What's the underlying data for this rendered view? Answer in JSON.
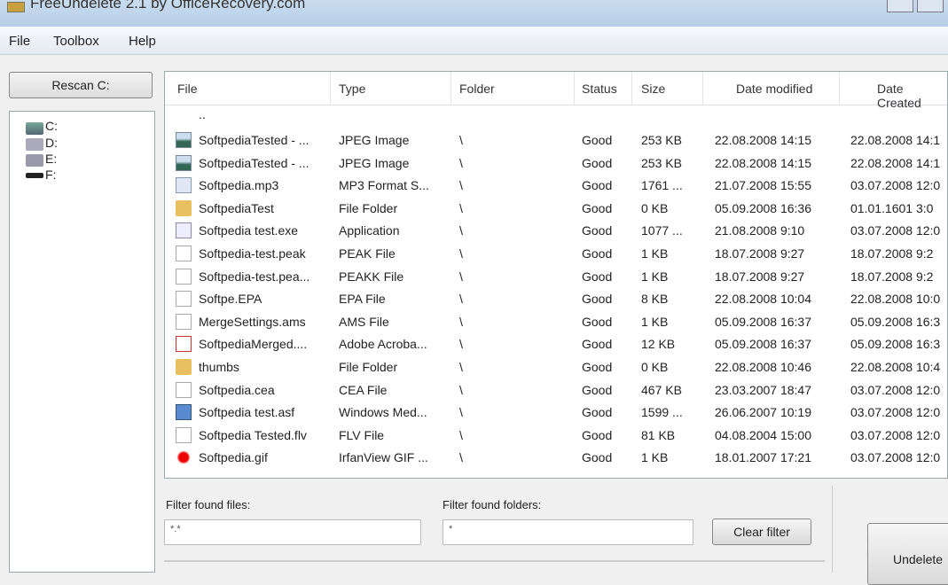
{
  "window": {
    "title": "FreeUndelete 2.1 by OfficeRecovery.com"
  },
  "menu": [
    "File",
    "Toolbox",
    "Help"
  ],
  "rescan_label": "Rescan C:",
  "drives": [
    "C:",
    "D:",
    "E:",
    "F:"
  ],
  "columns": [
    "File",
    "Type",
    "Folder",
    "Status",
    "Size",
    "Date modified",
    "Date Created"
  ],
  "parent_row": "..",
  "rows": [
    {
      "icon": "image-icon",
      "file": "SoftpediaTested - ...",
      "type": "JPEG Image",
      "folder": "\\",
      "status": "Good",
      "size": "253 KB",
      "modified": "22.08.2008 14:15",
      "created": "22.08.2008 14:1"
    },
    {
      "icon": "image-icon",
      "file": "SoftpediaTested - ...",
      "type": "JPEG Image",
      "folder": "\\",
      "status": "Good",
      "size": "253 KB",
      "modified": "22.08.2008 14:15",
      "created": "22.08.2008 14:1"
    },
    {
      "icon": "audio-icon",
      "file": "Softpedia.mp3",
      "type": "MP3 Format S...",
      "folder": "\\",
      "status": "Good",
      "size": "1761 ...",
      "modified": "21.07.2008 15:55",
      "created": "03.07.2008 12:0"
    },
    {
      "icon": "folder-icon",
      "file": "SoftpediaTest",
      "type": "File Folder",
      "folder": "\\",
      "status": "Good",
      "size": "0 KB",
      "modified": "05.09.2008 16:36",
      "created": "01.01.1601 3:0"
    },
    {
      "icon": "exe-icon",
      "file": "Softpedia test.exe",
      "type": "Application",
      "folder": "\\",
      "status": "Good",
      "size": "1077 ...",
      "modified": "21.08.2008 9:10",
      "created": "03.07.2008 12:0"
    },
    {
      "icon": "file-icon",
      "file": "Softpedia-test.peak",
      "type": "PEAK File",
      "folder": "\\",
      "status": "Good",
      "size": "1 KB",
      "modified": "18.07.2008 9:27",
      "created": "18.07.2008 9:2"
    },
    {
      "icon": "file-icon",
      "file": "Softpedia-test.pea...",
      "type": "PEAKK File",
      "folder": "\\",
      "status": "Good",
      "size": "1 KB",
      "modified": "18.07.2008 9:27",
      "created": "18.07.2008 9:2"
    },
    {
      "icon": "file-icon",
      "file": "Softpe.EPA",
      "type": "EPA File",
      "folder": "\\",
      "status": "Good",
      "size": "8 KB",
      "modified": "22.08.2008 10:04",
      "created": "22.08.2008 10:0"
    },
    {
      "icon": "file-icon",
      "file": "MergeSettings.ams",
      "type": "AMS File",
      "folder": "\\",
      "status": "Good",
      "size": "1 KB",
      "modified": "05.09.2008 16:37",
      "created": "05.09.2008 16:3"
    },
    {
      "icon": "pdf-icon",
      "file": "SoftpediaMerged....",
      "type": "Adobe Acroba...",
      "folder": "\\",
      "status": "Good",
      "size": "12 KB",
      "modified": "05.09.2008 16:37",
      "created": "05.09.2008 16:3"
    },
    {
      "icon": "folder-icon",
      "file": "thumbs",
      "type": "File Folder",
      "folder": "\\",
      "status": "Good",
      "size": "0 KB",
      "modified": "22.08.2008 10:46",
      "created": "22.08.2008 10:4"
    },
    {
      "icon": "file-icon",
      "file": "Softpedia.cea",
      "type": "CEA File",
      "folder": "\\",
      "status": "Good",
      "size": "467 KB",
      "modified": "23.03.2007 18:47",
      "created": "03.07.2008 12:0"
    },
    {
      "icon": "media-icon",
      "file": "Softpedia test.asf",
      "type": "Windows Med...",
      "folder": "\\",
      "status": "Good",
      "size": "1599 ...",
      "modified": "26.06.2007 10:19",
      "created": "03.07.2008 12:0"
    },
    {
      "icon": "file-icon",
      "file": "Softpedia Tested.flv",
      "type": "FLV File",
      "folder": "\\",
      "status": "Good",
      "size": "81 KB",
      "modified": "04.08.2004 15:00",
      "created": "03.07.2008 12:0"
    },
    {
      "icon": "gif-icon",
      "file": "Softpedia.gif",
      "type": "IrfanView GIF ...",
      "folder": "\\",
      "status": "Good",
      "size": "1 KB",
      "modified": "18.01.2007 17:21",
      "created": "03.07.2008 12:0"
    }
  ],
  "filter": {
    "files_label": "Filter found files:",
    "files_value": "*.*",
    "folders_label": "Filter found folders:",
    "folders_value": "*",
    "clear_label": "Clear filter"
  },
  "undelete_label": "Undelete"
}
